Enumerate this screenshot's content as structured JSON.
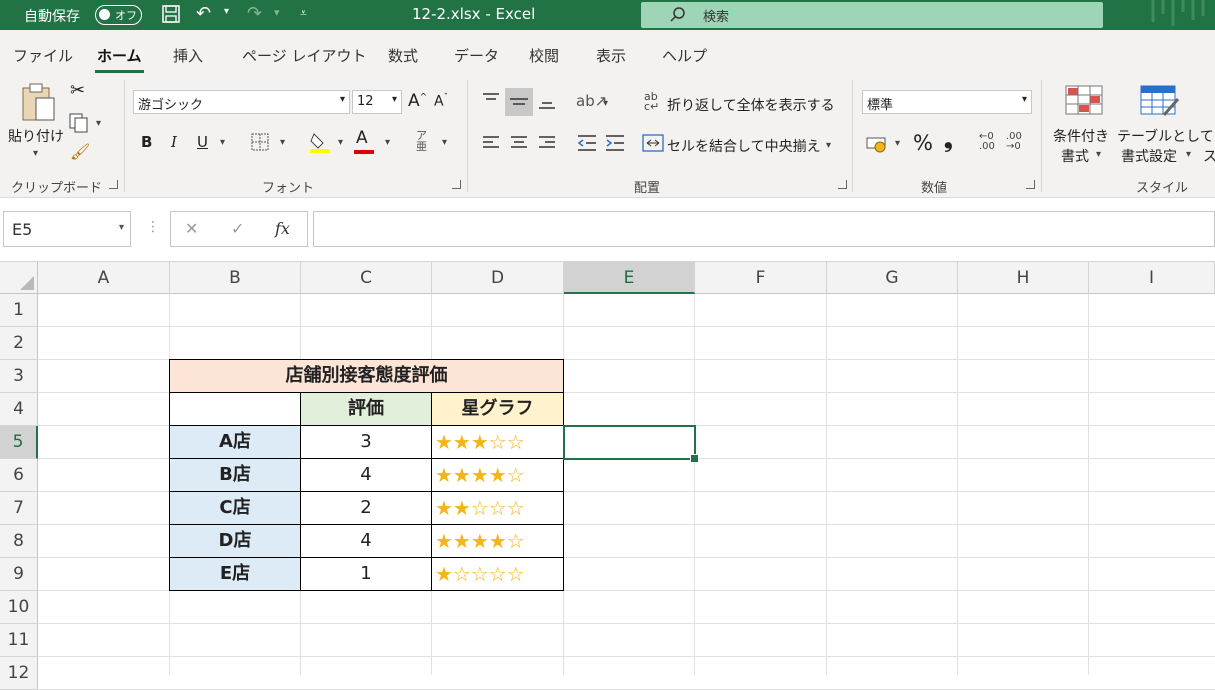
{
  "titlebar": {
    "autosave_label": "自動保存",
    "autosave_state": "オフ",
    "file_title": "12-2.xlsx  -  Excel",
    "search_placeholder": "検索",
    "accent": "#217346"
  },
  "tabs": [
    "ファイル",
    "ホーム",
    "挿入",
    "ページ レイアウト",
    "数式",
    "データ",
    "校閲",
    "表示",
    "ヘルプ"
  ],
  "ribbon": {
    "clipboard": {
      "paste_label": "貼り付け",
      "group": "クリップボード"
    },
    "font": {
      "name": "游ゴシック",
      "size": "12",
      "group": "フォント",
      "bold": "B",
      "italic": "I",
      "underline": "U",
      "grow": "A",
      "shrink": "A",
      "font_color_letter": "A"
    },
    "alignment": {
      "wrap_text": "折り返して全体を表示する",
      "merge_center": "セルを結合して中央揃え",
      "group": "配置"
    },
    "number": {
      "format": "標準",
      "percent": "%",
      "comma": "❟",
      "group": "数値"
    },
    "styles": {
      "conditional": [
        "条件付き",
        "書式"
      ],
      "table": [
        "テーブルとして",
        "書式設定"
      ],
      "more": "ス",
      "group": "スタイル"
    }
  },
  "formula_bar": {
    "name_box": "E5",
    "cancel": "✕",
    "enter": "✓",
    "fx": "fx",
    "value": ""
  },
  "sheet": {
    "columns": [
      "A",
      "B",
      "C",
      "D",
      "E",
      "F",
      "G",
      "H",
      "I"
    ],
    "rows": [
      "1",
      "2",
      "3",
      "4",
      "5",
      "6",
      "7",
      "8",
      "9",
      "10",
      "11",
      "12"
    ],
    "selected_cell": "E5",
    "table": {
      "title": "店舗別接客態度評価",
      "headers": [
        "",
        "評価",
        "星グラフ"
      ],
      "rows": [
        {
          "store": "A店",
          "rating": "3",
          "stars": "★★★☆☆"
        },
        {
          "store": "B店",
          "rating": "4",
          "stars": "★★★★☆"
        },
        {
          "store": "C店",
          "rating": "2",
          "stars": "★★☆☆☆"
        },
        {
          "store": "D店",
          "rating": "4",
          "stars": "★★★★☆"
        },
        {
          "store": "E店",
          "rating": "1",
          "stars": "★☆☆☆☆"
        }
      ],
      "colors": {
        "title_bg": "#fce4d6",
        "header_rating_bg": "#e2efda",
        "header_stars_bg": "#fff2cc",
        "store_bg": "#ddebf7",
        "star": "#f2b61a"
      }
    }
  }
}
